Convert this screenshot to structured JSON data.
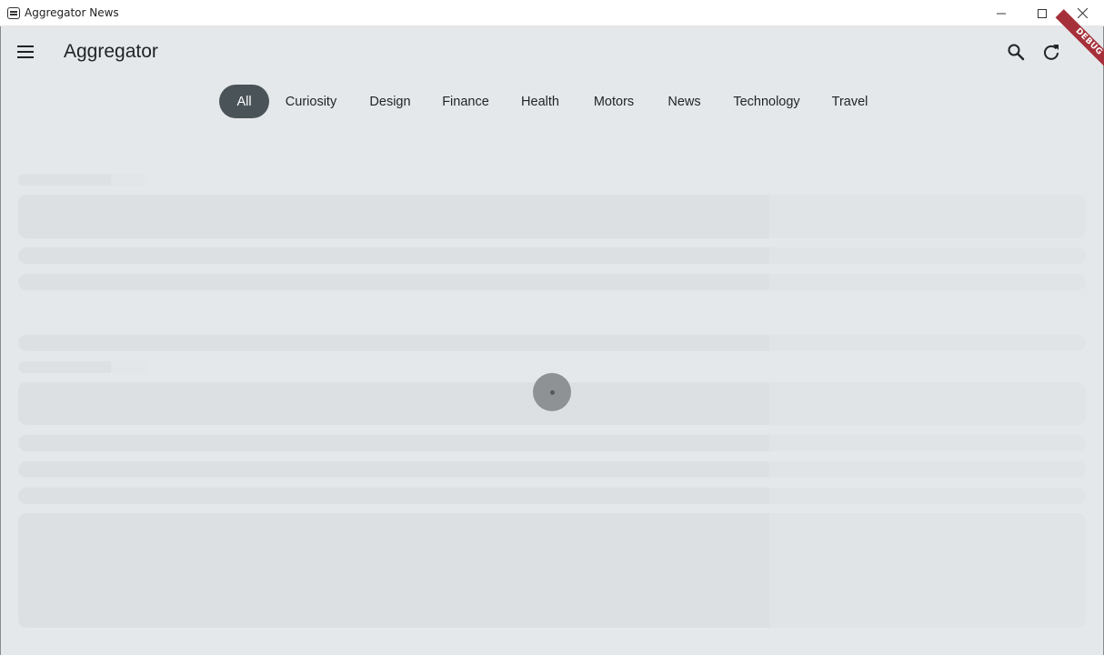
{
  "window": {
    "title": "Aggregator News"
  },
  "appbar": {
    "title": "Aggregator",
    "menu_icon": "hamburger-menu-icon",
    "search_icon": "search-icon",
    "refresh_icon": "refresh-icon"
  },
  "debug_banner": "DEBUG",
  "categories": [
    "All",
    "Curiosity",
    "Design",
    "Finance",
    "Health",
    "Motors",
    "News",
    "Technology",
    "Travel"
  ],
  "selected_category": "All",
  "loading": true,
  "colors": {
    "background": "#e5e8ea",
    "chip_selected": "#4a5358",
    "debug_banner": "#a6303a",
    "skeleton": "#dde0e2"
  }
}
